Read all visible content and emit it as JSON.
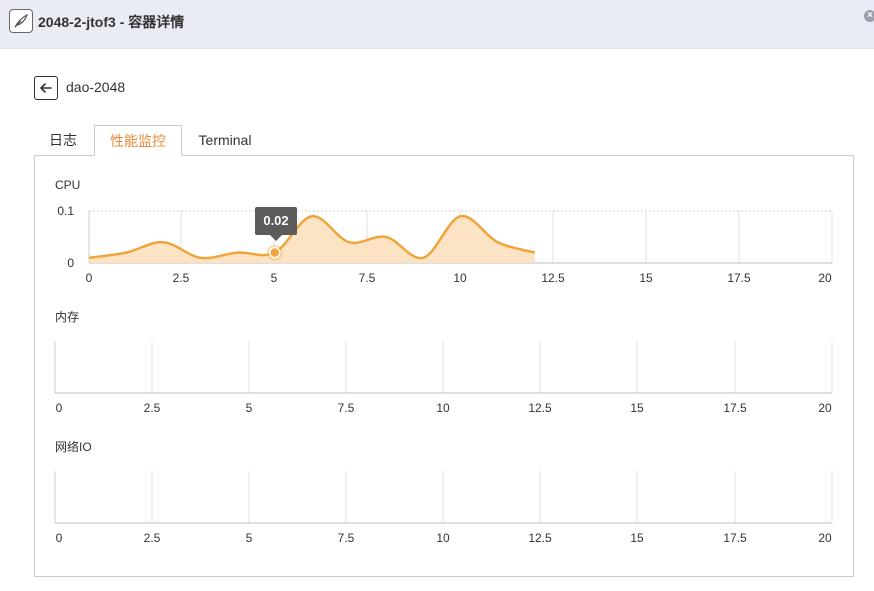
{
  "window": {
    "title": "2048-2-jtof3 - 容器详情",
    "app_icon": "feather-icon",
    "close_icon": "close-icon"
  },
  "header": {
    "back_icon": "arrow-left-icon",
    "container_name": "dao-2048"
  },
  "tabs": [
    {
      "label": "日志",
      "active": false
    },
    {
      "label": "性能监控",
      "active": true
    },
    {
      "label": "Terminal",
      "active": false
    }
  ],
  "colors": {
    "accent": "#e9893a",
    "line": "#f0a43c",
    "fill": "#fbe0bd",
    "grid": "#dddddd",
    "tooltip_bg": "#5b5b5b"
  },
  "chart_data": [
    {
      "type": "area",
      "title": "CPU",
      "xlim": [
        0,
        20
      ],
      "ylim": [
        0,
        0.1
      ],
      "x_ticks": [
        "0",
        "2.5",
        "5",
        "7.5",
        "10",
        "12.5",
        "15",
        "17.5",
        "20"
      ],
      "y_ticks": [
        "0.1",
        "0"
      ],
      "grid": true,
      "series": [
        {
          "x": [
            0,
            1,
            2,
            3,
            4,
            5,
            6,
            7,
            8,
            9,
            10,
            11,
            12
          ],
          "values": [
            0.01,
            0.02,
            0.04,
            0.01,
            0.02,
            0.02,
            0.09,
            0.04,
            0.05,
            0.01,
            0.09,
            0.04,
            0.02
          ]
        }
      ],
      "tooltip": {
        "x": 5,
        "value": "0.02"
      }
    },
    {
      "type": "area",
      "title": "内存",
      "xlim": [
        0,
        20
      ],
      "x_ticks": [
        "0",
        "2.5",
        "5",
        "7.5",
        "10",
        "12.5",
        "15",
        "17.5",
        "20"
      ],
      "grid": true,
      "series": []
    },
    {
      "type": "area",
      "title": "网络IO",
      "xlim": [
        0,
        20
      ],
      "x_ticks": [
        "0",
        "2.5",
        "5",
        "7.5",
        "10",
        "12.5",
        "15",
        "17.5",
        "20"
      ],
      "grid": true,
      "series": []
    }
  ]
}
